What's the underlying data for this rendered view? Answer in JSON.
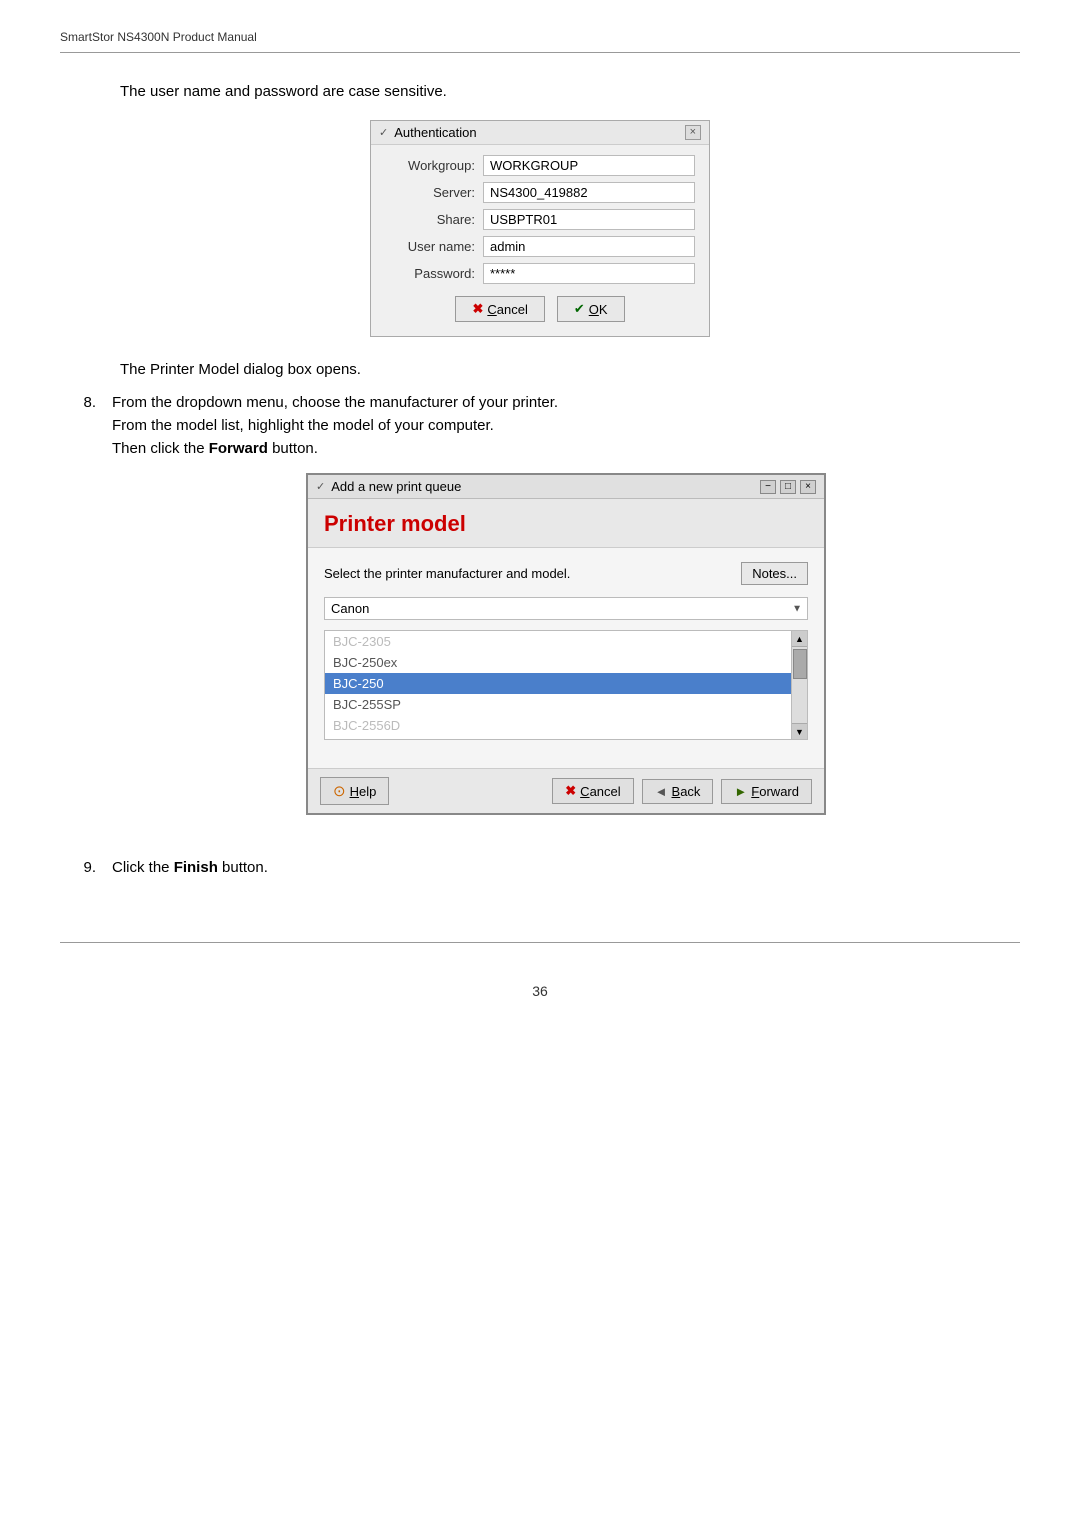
{
  "header": {
    "manual_title": "SmartStor NS4300N Product Manual"
  },
  "intro": {
    "text": "The user name and password are case sensitive."
  },
  "auth_dialog": {
    "title": "Authentication",
    "close_label": "×",
    "chevron": "✓",
    "fields": [
      {
        "label": "Workgroup:",
        "value": "WORKGROUP"
      },
      {
        "label": "Server:",
        "value": "NS4300_419882"
      },
      {
        "label": "Share:",
        "value": "USBPTR01"
      },
      {
        "label": "User name:",
        "value": "admin"
      },
      {
        "label": "Password:",
        "value": "*****"
      }
    ],
    "cancel_label": "Cancel",
    "ok_label": "OK"
  },
  "after_auth_text": "The Printer Model dialog box opens.",
  "step8": {
    "number": "8.",
    "lines": [
      "From the dropdown menu, choose the manufacturer of your printer.",
      "From the model list, highlight the model of your computer.",
      "Then click the Forward button."
    ],
    "bold_word": "Forward"
  },
  "print_dialog": {
    "title": "Add a new print queue",
    "section_title": "Printer model",
    "select_label": "Select the printer manufacturer and model.",
    "notes_btn": "Notes...",
    "manufacturer": "Canon",
    "models": [
      {
        "label": "BJC-2305",
        "state": "faded"
      },
      {
        "label": "BJC-250ex",
        "state": "normal"
      },
      {
        "label": "BJC-250",
        "state": "selected"
      },
      {
        "label": "BJC-255SP",
        "state": "normal"
      },
      {
        "label": "BJC-2556D",
        "state": "faded"
      }
    ],
    "help_btn": "Help",
    "cancel_btn": "Cancel",
    "back_btn": "Back",
    "forward_btn": "Forward"
  },
  "step9": {
    "number": "9.",
    "text": "Click the Finish button.",
    "bold_word": "Finish"
  },
  "footer": {
    "page_number": "36"
  }
}
